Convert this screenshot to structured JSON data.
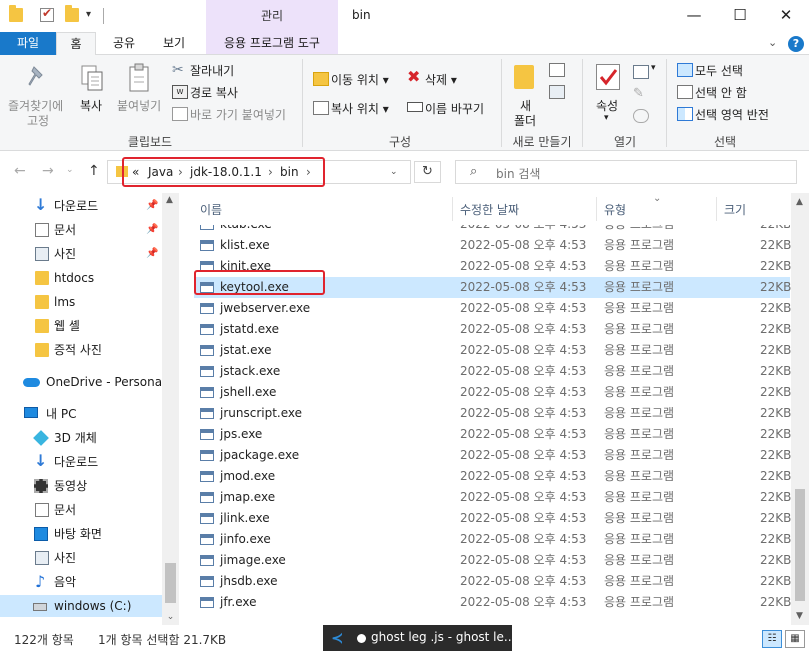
{
  "window": {
    "title": "bin",
    "context_tab": "관리"
  },
  "tabs": {
    "file": "파일",
    "home": "홈",
    "share": "공유",
    "view": "보기",
    "app_tools": "응용 프로그램 도구"
  },
  "ribbon": {
    "clipboard": {
      "pin": "즐겨찾기에\n고정",
      "pin_l1": "즐겨찾기에",
      "pin_l2": "고정",
      "copy": "복사",
      "paste": "붙여넣기",
      "cut": "잘라내기",
      "copy_path": "경로 복사",
      "paste_shortcut": "바로 가기 붙여넣기",
      "label": "클립보드"
    },
    "organize": {
      "move_to": "이동 위치",
      "copy_to": "복사 위치",
      "delete": "삭제",
      "rename": "이름 바꾸기",
      "label": "구성"
    },
    "new": {
      "new_folder_l1": "새",
      "new_folder_l2": "폴더",
      "label": "새로 만들기"
    },
    "open": {
      "properties": "속성",
      "label": "열기"
    },
    "select": {
      "select_all": "모두 선택",
      "select_none": "선택 안 함",
      "invert": "선택 영역 반전",
      "label": "선택"
    }
  },
  "address": {
    "overflow": "«",
    "crumbs": [
      "Java",
      "jdk-18.0.1.1",
      "bin"
    ],
    "search_placeholder": "bin 검색"
  },
  "navpane": {
    "items": [
      {
        "label": "다운로드",
        "icon": "download-icon",
        "pinned": true
      },
      {
        "label": "문서",
        "icon": "document-icon",
        "pinned": true
      },
      {
        "label": "사진",
        "icon": "pictures-icon",
        "pinned": true
      },
      {
        "label": "htdocs",
        "icon": "folder-icon"
      },
      {
        "label": "lms",
        "icon": "folder-icon"
      },
      {
        "label": "웹 셸",
        "icon": "folder-icon"
      },
      {
        "label": "증적 사진",
        "icon": "folder-icon"
      },
      {
        "label": "OneDrive - Personal",
        "icon": "onedrive-icon"
      },
      {
        "label": "내 PC",
        "icon": "pc-icon"
      },
      {
        "label": "3D 개체",
        "icon": "3d-objects-icon"
      },
      {
        "label": "다운로드",
        "icon": "download-icon"
      },
      {
        "label": "동영상",
        "icon": "video-icon"
      },
      {
        "label": "문서",
        "icon": "document-icon"
      },
      {
        "label": "바탕 화면",
        "icon": "desktop-icon"
      },
      {
        "label": "사진",
        "icon": "pictures-icon"
      },
      {
        "label": "음악",
        "icon": "music-icon"
      },
      {
        "label": "windows (C:)",
        "icon": "drive-icon",
        "selected": true
      }
    ],
    "pin_glyph": "📌"
  },
  "columns": {
    "name": "이름",
    "date": "수정한 날짜",
    "type": "유형",
    "size": "크기"
  },
  "files": {
    "date": "2022-05-08 오후 4:53",
    "type": "응용 프로그램",
    "size": "22KB",
    "rows": [
      {
        "name": "ktab.exe"
      },
      {
        "name": "klist.exe"
      },
      {
        "name": "kinit.exe"
      },
      {
        "name": "keytool.exe",
        "selected": true
      },
      {
        "name": "jwebserver.exe"
      },
      {
        "name": "jstatd.exe"
      },
      {
        "name": "jstat.exe"
      },
      {
        "name": "jstack.exe"
      },
      {
        "name": "jshell.exe"
      },
      {
        "name": "jrunscript.exe"
      },
      {
        "name": "jps.exe"
      },
      {
        "name": "jpackage.exe"
      },
      {
        "name": "jmod.exe"
      },
      {
        "name": "jmap.exe"
      },
      {
        "name": "jlink.exe"
      },
      {
        "name": "jinfo.exe"
      },
      {
        "name": "jimage.exe"
      },
      {
        "name": "jhsdb.exe"
      },
      {
        "name": "jfr.exe"
      }
    ]
  },
  "status": {
    "count": "122개 항목",
    "selection": "1개 항목 선택함 21.7KB",
    "taskbar_popup": "ghost leg .js - ghost le..."
  },
  "colors": {
    "accent": "#1979ca",
    "selection": "#cce8ff",
    "highlight": "#e0242e",
    "context_tab": "#ede2fa"
  }
}
